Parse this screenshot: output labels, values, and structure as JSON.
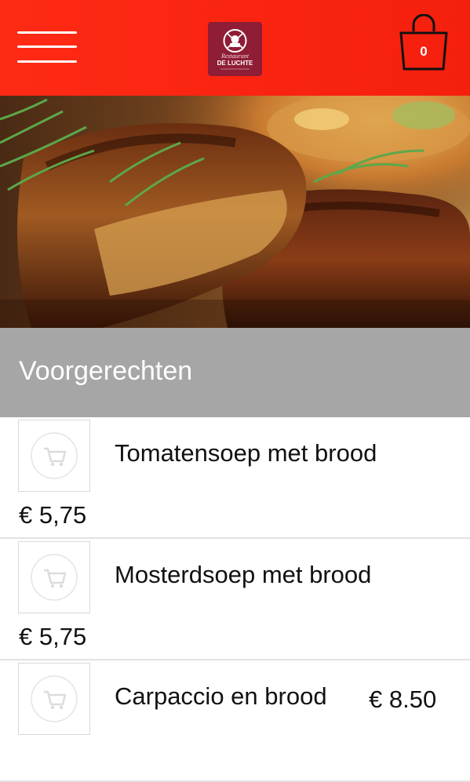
{
  "header": {
    "menu_icon": "hamburger-icon",
    "logo_icon": "restaurant-logo-icon",
    "logo_text": "DE LUCHTE",
    "cart_icon": "shopping-bag-icon",
    "cart_count": "0",
    "colors": {
      "background": "#f5240f",
      "logo_bg": "#8e1d35"
    }
  },
  "hero": {
    "image": "grilled-spare-ribs-photo"
  },
  "category": {
    "title": "Voorgerechten",
    "color": "#a6a6a6"
  },
  "items": [
    {
      "name": "Tomatensoep met brood",
      "price": "€ 5,75",
      "icon": "cart-icon"
    },
    {
      "name": "Mosterdsoep met brood",
      "price": "€ 5,75",
      "icon": "cart-icon"
    },
    {
      "name": "Carpaccio en brood",
      "price": "€ 8.50",
      "icon": "cart-icon"
    }
  ]
}
